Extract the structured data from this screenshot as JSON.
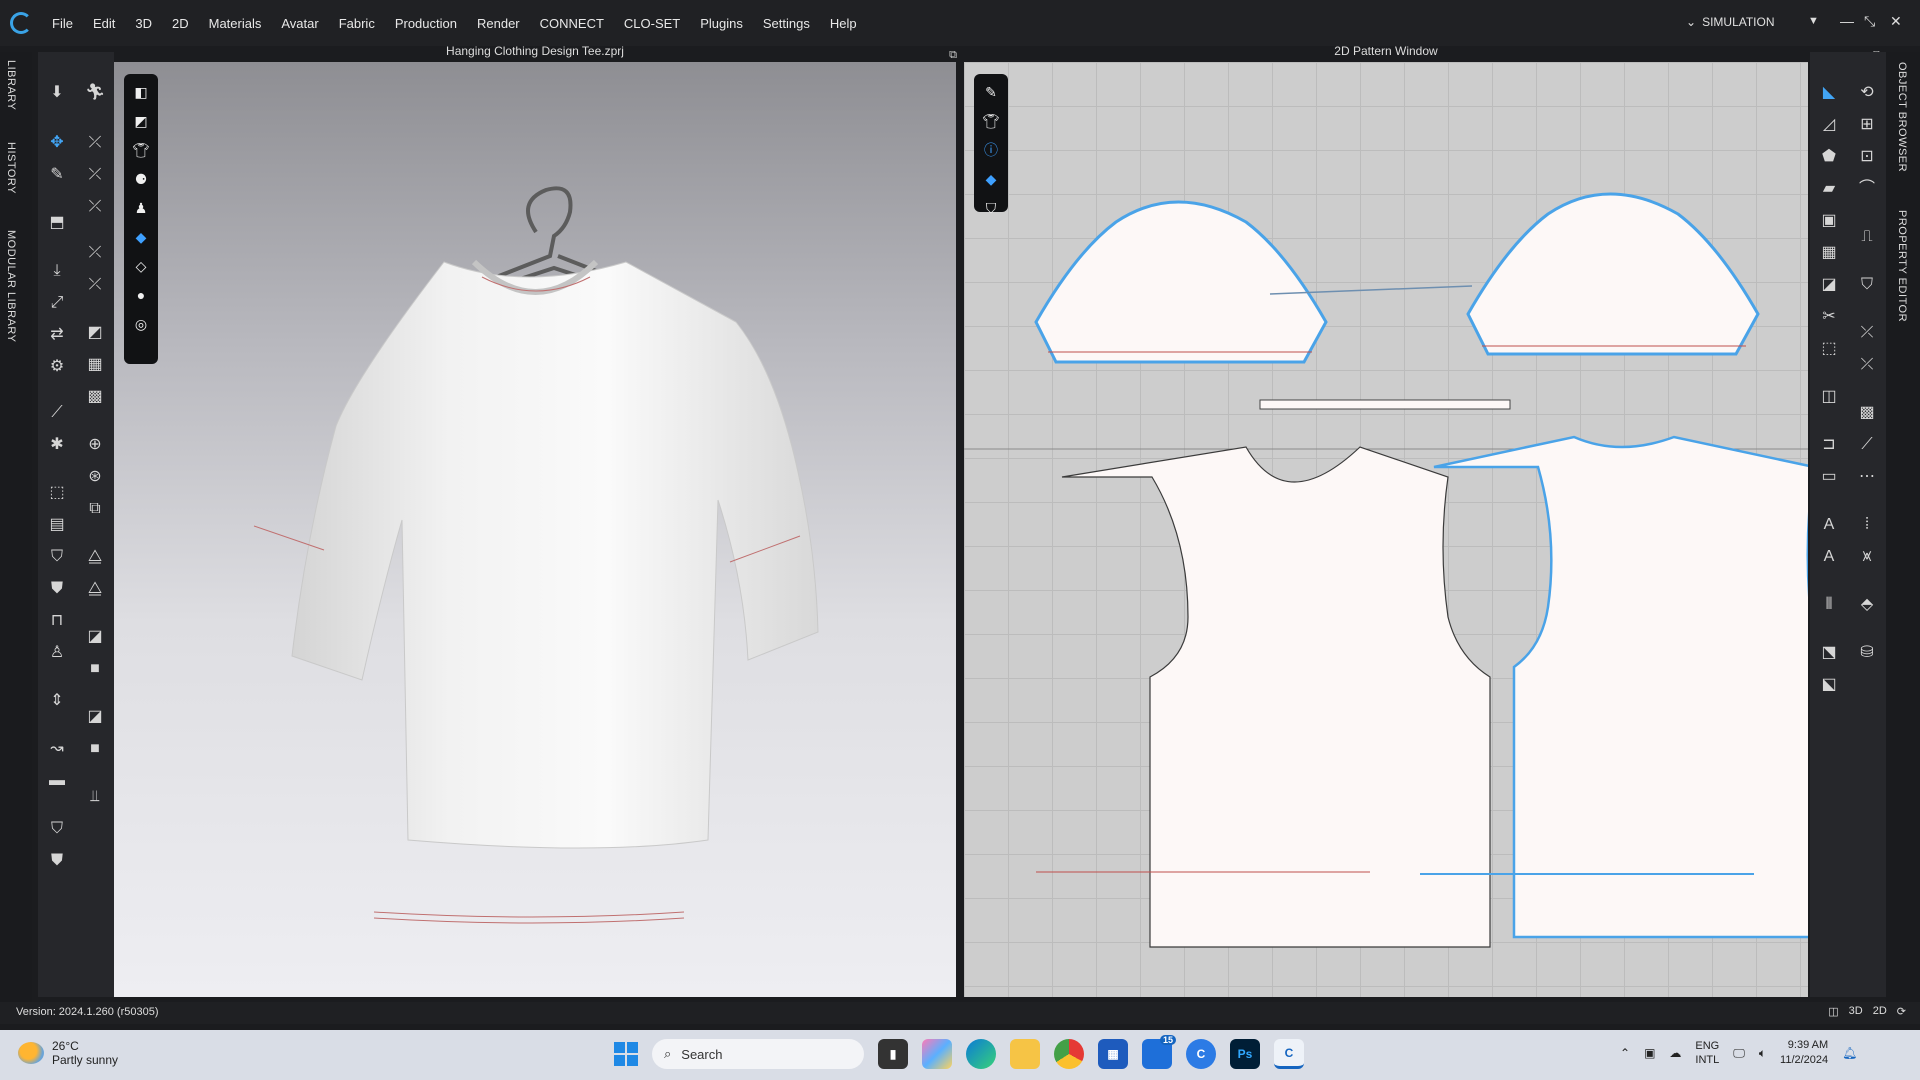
{
  "menu": [
    "File",
    "Edit",
    "3D",
    "2D",
    "Materials",
    "Avatar",
    "Fabric",
    "Production",
    "Render",
    "CONNECT",
    "CLO-SET",
    "Plugins",
    "Settings",
    "Help"
  ],
  "mode": {
    "label": "SIMULATION"
  },
  "left_tabs": [
    "LIBRARY",
    "HISTORY",
    "MODULAR LIBRARY"
  ],
  "right_tabs": [
    "OBJECT BROWSER",
    "PROPERTY EDITOR"
  ],
  "viewport3d": {
    "title": "Hanging Clothing Design Tee.zprj"
  },
  "pattern_window": {
    "title": "2D Pattern Window"
  },
  "status": {
    "version": "Version: 2024.1.260 (r50305)"
  },
  "taskbar": {
    "weather_temp": "26°C",
    "weather_desc": "Partly sunny",
    "search_placeholder": "Search",
    "mail_badge": "15",
    "ps_label": "Ps",
    "lang_top": "ENG",
    "lang_bottom": "INTL",
    "time": "9:39 AM",
    "date": "11/2/2024"
  },
  "colors": {
    "accent": "#3aa3e6",
    "pattern_selected": "#4aa3e8",
    "seam_red": "#c0504d"
  }
}
